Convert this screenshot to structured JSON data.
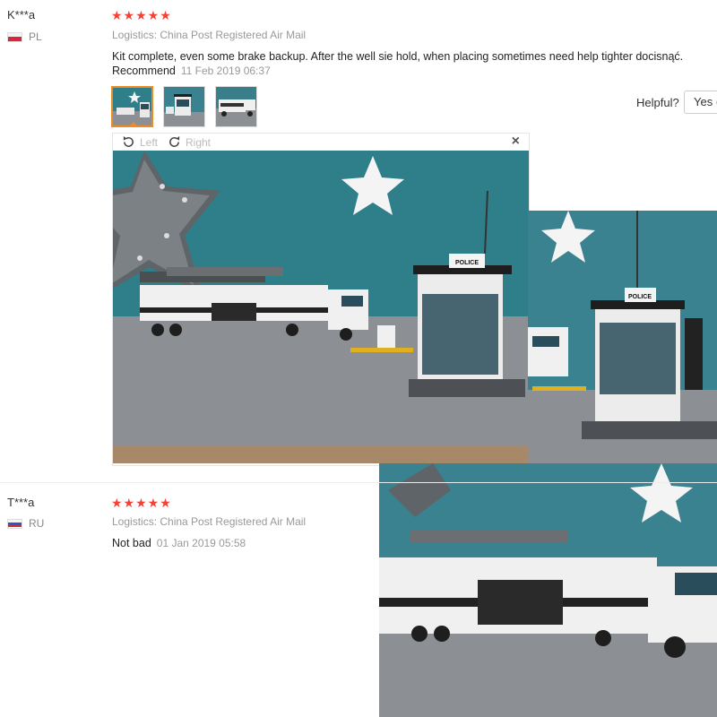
{
  "reviews": [
    {
      "user": "K***a",
      "country": "PL",
      "rating_stars": "★★★★★",
      "rating": 5,
      "logistics": "Logistics: China Post Registered Air Mail",
      "text": "Kit complete, even some brake backup. After the well sie hold, when placing sometimes need help tighter docisnąć.",
      "text_line2": "Recommend",
      "date": "11 Feb 2019 06:37",
      "helpful_label": "Helpful?",
      "yes_label": "Yes ("
    },
    {
      "user": "T***a",
      "country": "RU",
      "rating_stars": "★★★★★",
      "rating": 5,
      "logistics": "Logistics: China Post Registered Air Mail",
      "text": "Not bad",
      "date": "01 Jan 2019 05:58"
    }
  ],
  "viewer": {
    "rotate_left": "Left",
    "rotate_right": "Right",
    "close": "×",
    "photo_sign": "POLICE"
  },
  "colors": {
    "star": "#f44336",
    "accent": "#f08a24",
    "wall": "#2f7f8a",
    "floor": "#8c8f93"
  }
}
